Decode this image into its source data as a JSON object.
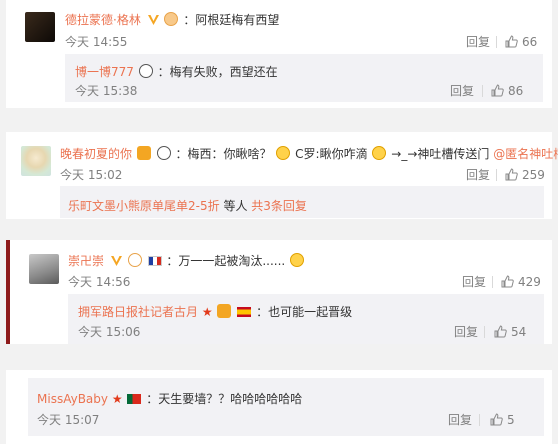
{
  "comments": [
    {
      "user": "德拉蒙德·格林",
      "text": "：阿根廷梅有西望",
      "time": "今天 14:55",
      "reply_label": "回复",
      "likes": "66",
      "reply": {
        "user": "博一博777",
        "text": "：梅有失败，西望还在",
        "time": "今天 15:38",
        "reply_label": "回复",
        "likes": "86"
      }
    },
    {
      "user": "晚春初夏的你",
      "text_a": "：梅西：你瞅啥？",
      "text_b": "C罗:瞅你咋滴",
      "text_c": "→_→神吐槽传送门",
      "mention": "@匿名神吐槽",
      "time": "今天 15:02",
      "reply_label": "回复",
      "likes": "259",
      "footer_user": "乐町文墨小熊原单尾单2-5折",
      "footer_text": " 等人 ",
      "footer_count": "共3条回复"
    },
    {
      "user": "崇卍崇",
      "text": "：万一一起被淘汰......",
      "time": "今天 14:56",
      "reply_label": "回复",
      "likes": "429",
      "reply": {
        "user": "拥军路日报社记者古月",
        "text": "：也可能一起晋级",
        "time": "今天 15:06",
        "reply_label": "回复",
        "likes": "54"
      }
    },
    {
      "user": "MissAyBaby",
      "text": "：天生要墙？？哈哈哈哈哈哈",
      "time": "今天 15:07",
      "reply_label": "回复",
      "likes": "5"
    }
  ]
}
